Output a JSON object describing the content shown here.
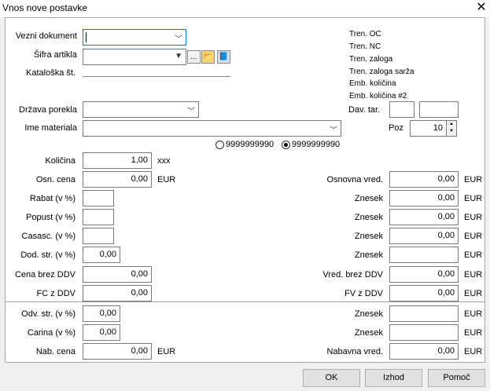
{
  "window": {
    "title": "Vnos nove postavke"
  },
  "header": {
    "vezni_dokument_label": "Vezni dokument",
    "sifra_artikla_label": "Šifra artikla",
    "kataloska_label": "Kataloška št.",
    "drzava_label": "Država porekla",
    "ime_materiala_label": "Ime materiala",
    "lookup_btn": "...",
    "info": {
      "tren_oc": "Tren. OC",
      "tren_nc": "Tren. NC",
      "tren_zaloga": "Tren. zaloga",
      "tren_zaloga_sarza": "Tren. zaloga sarža",
      "emb_kolicina": "Emb. količina",
      "emb_kolicina2": "Emb. količina #2"
    },
    "dav_tar_label": "Dav. tar.",
    "poz_label": "Poz",
    "poz_value": "10",
    "radio1": "9999999990",
    "radio2": "9999999990"
  },
  "left": {
    "kolicina_label": "Količina",
    "kolicina_value": "1,00",
    "kolicina_unit": "xxx",
    "osn_cena_label": "Osn. cena",
    "osn_cena_value": "0,00",
    "osn_cena_unit": "EUR",
    "rabat_label": "Rabat (v %)",
    "popust_label": "Popust (v %)",
    "casasc_label": "Casasc. (v %)",
    "dod_str_label": "Dod. str. (v %)",
    "dod_str_value": "0,00",
    "cena_brez_label": "Cena brez DDV",
    "cena_brez_value": "0,00",
    "fc_label": "FC z DDV",
    "fc_value": "0,00",
    "odv_label": "Odv. str. (v %)",
    "odv_value": "0,00",
    "carina_label": "Carina (v %)",
    "carina_value": "0,00",
    "nab_cena_label": "Nab. cena",
    "nab_cena_value": "0,00",
    "nab_cena_unit": "EUR"
  },
  "right": {
    "osnovna_label": "Osnovna vred.",
    "osnovna_value": "0,00",
    "znesek_label": "Znesek",
    "znesek_rabat": "0,00",
    "znesek_popust": "0,00",
    "znesek_casasc": "0,00",
    "vred_brez_label": "Vred. brez DDV",
    "vred_brez_value": "0,00",
    "fv_label": "FV z DDV",
    "fv_value": "0,00",
    "nabavna_label": "Nabavna vred.",
    "nabavna_value": "0,00",
    "unit": "EUR"
  },
  "buttons": {
    "ok": "OK",
    "izhod": "Izhod",
    "pomoc": "Pomoč"
  }
}
